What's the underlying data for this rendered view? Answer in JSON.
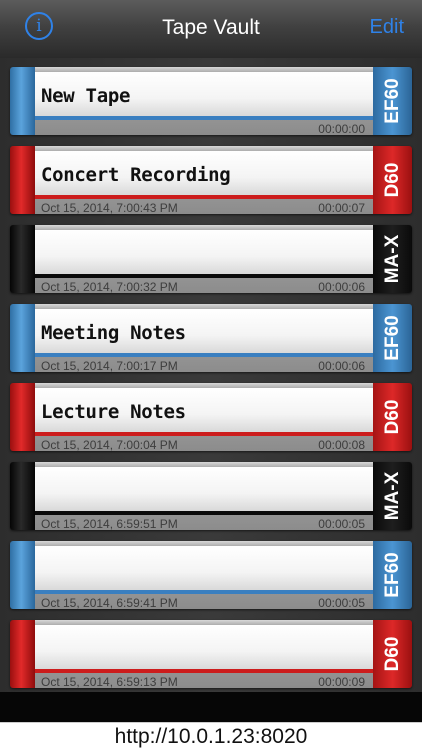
{
  "nav": {
    "title": "Tape Vault",
    "info_label": "i",
    "edit_label": "Edit",
    "accent_color": "#2f82e8"
  },
  "tapes": [
    {
      "title": "New Tape",
      "date": "",
      "duration": "00:00:00",
      "type": "EF60",
      "color": "blue"
    },
    {
      "title": "Concert Recording",
      "date": "Oct 15, 2014, 7:00:43 PM",
      "duration": "00:00:07",
      "type": "D60",
      "color": "red"
    },
    {
      "title": "",
      "date": "Oct 15, 2014, 7:00:32 PM",
      "duration": "00:00:06",
      "type": "MA-X",
      "color": "black"
    },
    {
      "title": "Meeting Notes",
      "date": "Oct 15, 2014, 7:00:17 PM",
      "duration": "00:00:06",
      "type": "EF60",
      "color": "blue"
    },
    {
      "title": "Lecture Notes",
      "date": "Oct 15, 2014, 7:00:04 PM",
      "duration": "00:00:08",
      "type": "D60",
      "color": "red"
    },
    {
      "title": "",
      "date": "Oct 15, 2014, 6:59:51 PM",
      "duration": "00:00:05",
      "type": "MA-X",
      "color": "black"
    },
    {
      "title": "",
      "date": "Oct 15, 2014, 6:59:41 PM",
      "duration": "00:00:05",
      "type": "EF60",
      "color": "blue"
    },
    {
      "title": "",
      "date": "Oct 15, 2014, 6:59:13 PM",
      "duration": "00:00:09",
      "type": "D60",
      "color": "red"
    }
  ],
  "footer": {
    "url": "http://10.0.1.23:8020"
  }
}
